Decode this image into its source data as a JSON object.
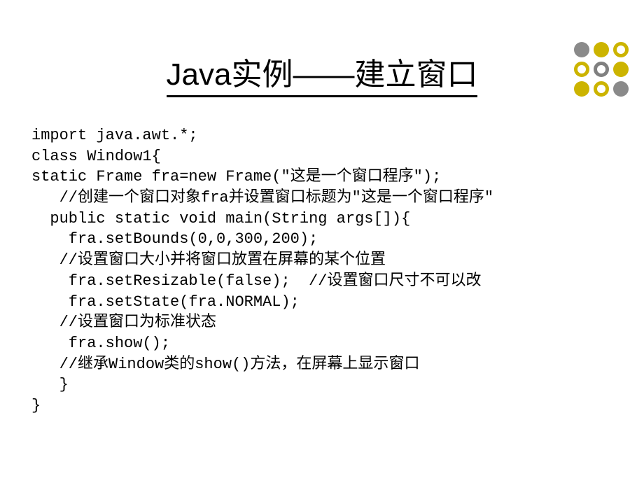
{
  "title": "Java实例——建立窗口",
  "code": {
    "line1": "import java.awt.*;",
    "line2": "class Window1{",
    "line3": "static Frame fra=new Frame(\"这是一个窗口程序\");",
    "line4": "   //创建一个窗口对象fra并设置窗口标题为\"这是一个窗口程序\"",
    "line5": "  public static void main(String args[]){",
    "line6": "    fra.setBounds(0,0,300,200);",
    "line7": "   //设置窗口大小并将窗口放置在屏幕的某个位置",
    "line8": "    fra.setResizable(false);  //设置窗口尺寸不可以改",
    "line9": "    fra.setState(fra.NORMAL);",
    "line10": "   //设置窗口为标准状态",
    "line11": "    fra.show();",
    "line12": "   //继承Window类的show()方法，在屏幕上显示窗口",
    "line13": "   }",
    "line14": "}"
  }
}
